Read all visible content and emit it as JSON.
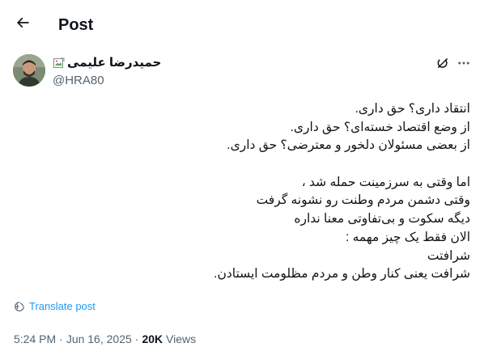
{
  "header": {
    "title": "Post",
    "back_icon": "arrow-left-icon"
  },
  "author": {
    "display_name": "حمیدرضا علیمی",
    "handle": "@HRA80",
    "avatar_icon": "user-avatar",
    "verified_icon": "broken-image-icon"
  },
  "actions": {
    "grok_icon": "grok-icon",
    "more_icon": "more-horizontal-icon"
  },
  "tweet": {
    "lines": [
      "انتقاد داری؟ حق داری.",
      "از وضع اقتصاد خسته‌ای؟ حق داری.",
      "از بعضی مسئولان دلخور و معترضی؟ حق داری.",
      "",
      "اما وقتی به سرزمینت حمله شد ،",
      "وقتی دشمن مردم وطنت رو نشونه گرفت",
      "دیگه سکوت و بی‌تفاوتی معنا نداره",
      "الان فقط یک چیز مهمه :",
      "شرافتت",
      "شرافت یعنی کنار وطن و مردم مظلومت ایستادن."
    ]
  },
  "translate": {
    "label": "Translate post",
    "icon": "translate-globe-icon"
  },
  "meta": {
    "time": "5:24 PM",
    "separator1": "·",
    "date": "Jun 16, 2025",
    "separator2": "·",
    "views_count": "20K",
    "views_label": "Views"
  },
  "colors": {
    "accent": "#1d9bf0",
    "text": "#0f1419",
    "muted": "#536471"
  }
}
